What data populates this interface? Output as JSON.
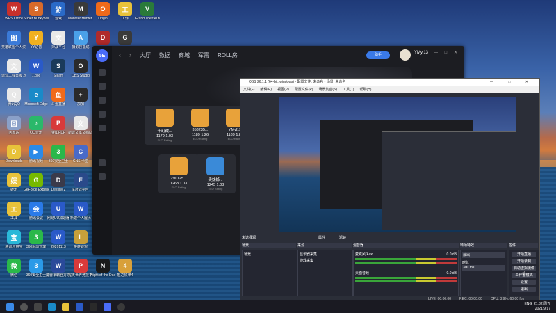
{
  "desktop": {
    "icons": [
      {
        "label": "WPS Office",
        "color": "#c8302c",
        "glyph": "W"
      },
      {
        "label": "Super Bunkyball ...",
        "color": "#d96a2a",
        "glyph": "S"
      },
      {
        "label": "游戏",
        "color": "#2a6ac8",
        "glyph": "游"
      },
      {
        "label": "Monster Hunter...",
        "color": "#3a3a3a",
        "glyph": "M"
      },
      {
        "label": "Origin",
        "color": "#f06a1a",
        "glyph": "O"
      },
      {
        "label": "工作",
        "color": "#e8c23a",
        "glyph": "工"
      },
      {
        "label": "Grand Theft Auto V",
        "color": "#2a7a3a",
        "glyph": "V"
      },
      {
        "label": "英雄联盟个人资 料1",
        "color": "#3a7ad8",
        "glyph": "图"
      },
      {
        "label": "YY语音",
        "color": "#f0b020",
        "glyph": "Y"
      },
      {
        "label": "对战平台",
        "color": "#e8e8e8",
        "glyph": "文"
      },
      {
        "label": "摄影技能成",
        "color": "#4aa0e8",
        "glyph": "A"
      },
      {
        "label": "",
        "color": "#b02a2a",
        "glyph": "D"
      },
      {
        "label": "",
        "color": "#3a3a3a",
        "glyph": "G"
      },
      {
        "label": "运营工程日报 20210504",
        "color": "#e8e8e8",
        "glyph": "文"
      },
      {
        "label": "1.doc",
        "color": "#2a5ac8",
        "glyph": "W"
      },
      {
        "label": "Steam",
        "color": "#1a3a5a",
        "glyph": "S"
      },
      {
        "label": "OBS Studio",
        "color": "#2a2a2a",
        "glyph": "O"
      },
      {
        "label": "腾讯QQ",
        "color": "#e8e8e8",
        "glyph": "Q"
      },
      {
        "label": "Microsoft Edge",
        "color": "#1a8ac8",
        "glyph": "e"
      },
      {
        "label": "斗鱼直播",
        "color": "#f06a1a",
        "glyph": "鱼"
      },
      {
        "label": "加加",
        "color": "#2a2a2a",
        "glyph": "+"
      },
      {
        "label": "回收站",
        "color": "#8aa0c8",
        "glyph": "回"
      },
      {
        "label": "QQ音乐",
        "color": "#2ab86a",
        "glyph": "♪"
      },
      {
        "label": "金山PDF",
        "color": "#d83a3a",
        "glyph": "P"
      },
      {
        "label": "新建文本文档(2)",
        "color": "#e8e8e8",
        "glyph": "文"
      },
      {
        "label": "Downloads",
        "color": "#e8c23a",
        "glyph": "D"
      },
      {
        "label": "腾讯视频",
        "color": "#2a8ae8",
        "glyph": "▶"
      },
      {
        "label": "360安全卫士",
        "color": "#2ab84a",
        "glyph": "3"
      },
      {
        "label": "CNSI卡密",
        "color": "#4a6ac8",
        "glyph": "C"
      },
      {
        "label": "娱乐",
        "color": "#e8c23a",
        "glyph": "娱"
      },
      {
        "label": "GeForce Experience",
        "color": "#76b900",
        "glyph": "G"
      },
      {
        "label": "Destiny 2",
        "color": "#3a3a4a",
        "glyph": "D"
      },
      {
        "label": "E对战平台",
        "color": "#2a4a8a",
        "glyph": "E"
      },
      {
        "label": "工具",
        "color": "#e8c23a",
        "glyph": "工"
      },
      {
        "label": "腾讯会议",
        "color": "#2a7ae8",
        "glyph": "会"
      },
      {
        "label": "网易UU加速器",
        "color": "#2a5ac8",
        "glyph": "U"
      },
      {
        "label": "新建个人履历",
        "color": "#2a5ac8",
        "glyph": "W"
      },
      {
        "label": "腾讯应用宝",
        "color": "#2ab8d8",
        "glyph": "宝"
      },
      {
        "label": "360驱动管理",
        "color": "#2ab84a",
        "glyph": "3"
      },
      {
        "label": "20201113",
        "color": "#2a5ac8",
        "glyph": "W"
      },
      {
        "label": "英雄联盟",
        "color": "#c8a03a",
        "glyph": "L"
      },
      {
        "label": "微信",
        "color": "#2ab84a",
        "glyph": "微"
      },
      {
        "label": "360安全卫士",
        "color": "#2a9ae8",
        "glyph": "3"
      },
      {
        "label": "魔兽争霸官方对战平台",
        "color": "#2a4a9a",
        "glyph": "W"
      },
      {
        "label": "完美世界竞技平台",
        "color": "#d83a3a",
        "glyph": "P"
      },
      {
        "label": "Night of the Dead",
        "color": "#1a1a1a",
        "glyph": "N"
      },
      {
        "label": "怒之铁拳4",
        "color": "#d8a03a",
        "glyph": "4"
      }
    ]
  },
  "client": {
    "tabs": [
      "大厅",
      "数据",
      "商城",
      "军需",
      "ROLL房"
    ],
    "ai_label": "助手",
    "username": "YMyl13",
    "players": [
      {
        "name": "千幻藏...",
        "elo": "1179",
        "rating": "1.03"
      },
      {
        "name": "353235...",
        "elo": "1189",
        "rating": "1.26"
      },
      {
        "name": "YMyl13",
        "elo": "1189",
        "rating": "1.81"
      },
      {
        "name": "290125...",
        "elo": "1263",
        "rating": "1.03"
      },
      {
        "name": "奥姊姊...",
        "elo": "1245",
        "rating": "1.03"
      }
    ],
    "elo_label": "ELO",
    "rating_label": "Rating"
  },
  "obs": {
    "title": "OBS 26.1.1 (64-bit, windows) - 配置文件: 未命名 - 场景: 未命名",
    "menu": [
      "文件(F)",
      "编辑(E)",
      "视图(V)",
      "配置文件(P)",
      "场景集合(S)",
      "工具(T)",
      "帮助(H)"
    ],
    "not_selected": "未选择源",
    "attributes": "属性",
    "filters": "滤镜",
    "dock_scenes": "场景",
    "dock_sources": "来源",
    "dock_mixer": "混音器",
    "dock_transitions": "转场特效",
    "dock_controls": "控件",
    "scene_name": "场景",
    "sources": [
      "显示器采集",
      "游戏采集"
    ],
    "mixer_tracks": [
      {
        "name": "麦克风/Aux",
        "db": "0.0 dB"
      },
      {
        "name": "桌面音频",
        "db": "0.0 dB"
      }
    ],
    "transition": "淡出",
    "duration_label": "时长",
    "duration_value": "300 ms",
    "controls": [
      "开始直播",
      "开始录制",
      "启动虚拟摄像机",
      "工作室模式",
      "设置",
      "退出"
    ],
    "status": {
      "live": "LIVE: 00:00:00",
      "rec": "REC: 00:00:00",
      "cpu": "CPU: 3.9%, 60.00 fps"
    }
  },
  "taskbar": {
    "lang": "ENG",
    "time": "21:32 周五",
    "date": "2021/9/17"
  }
}
